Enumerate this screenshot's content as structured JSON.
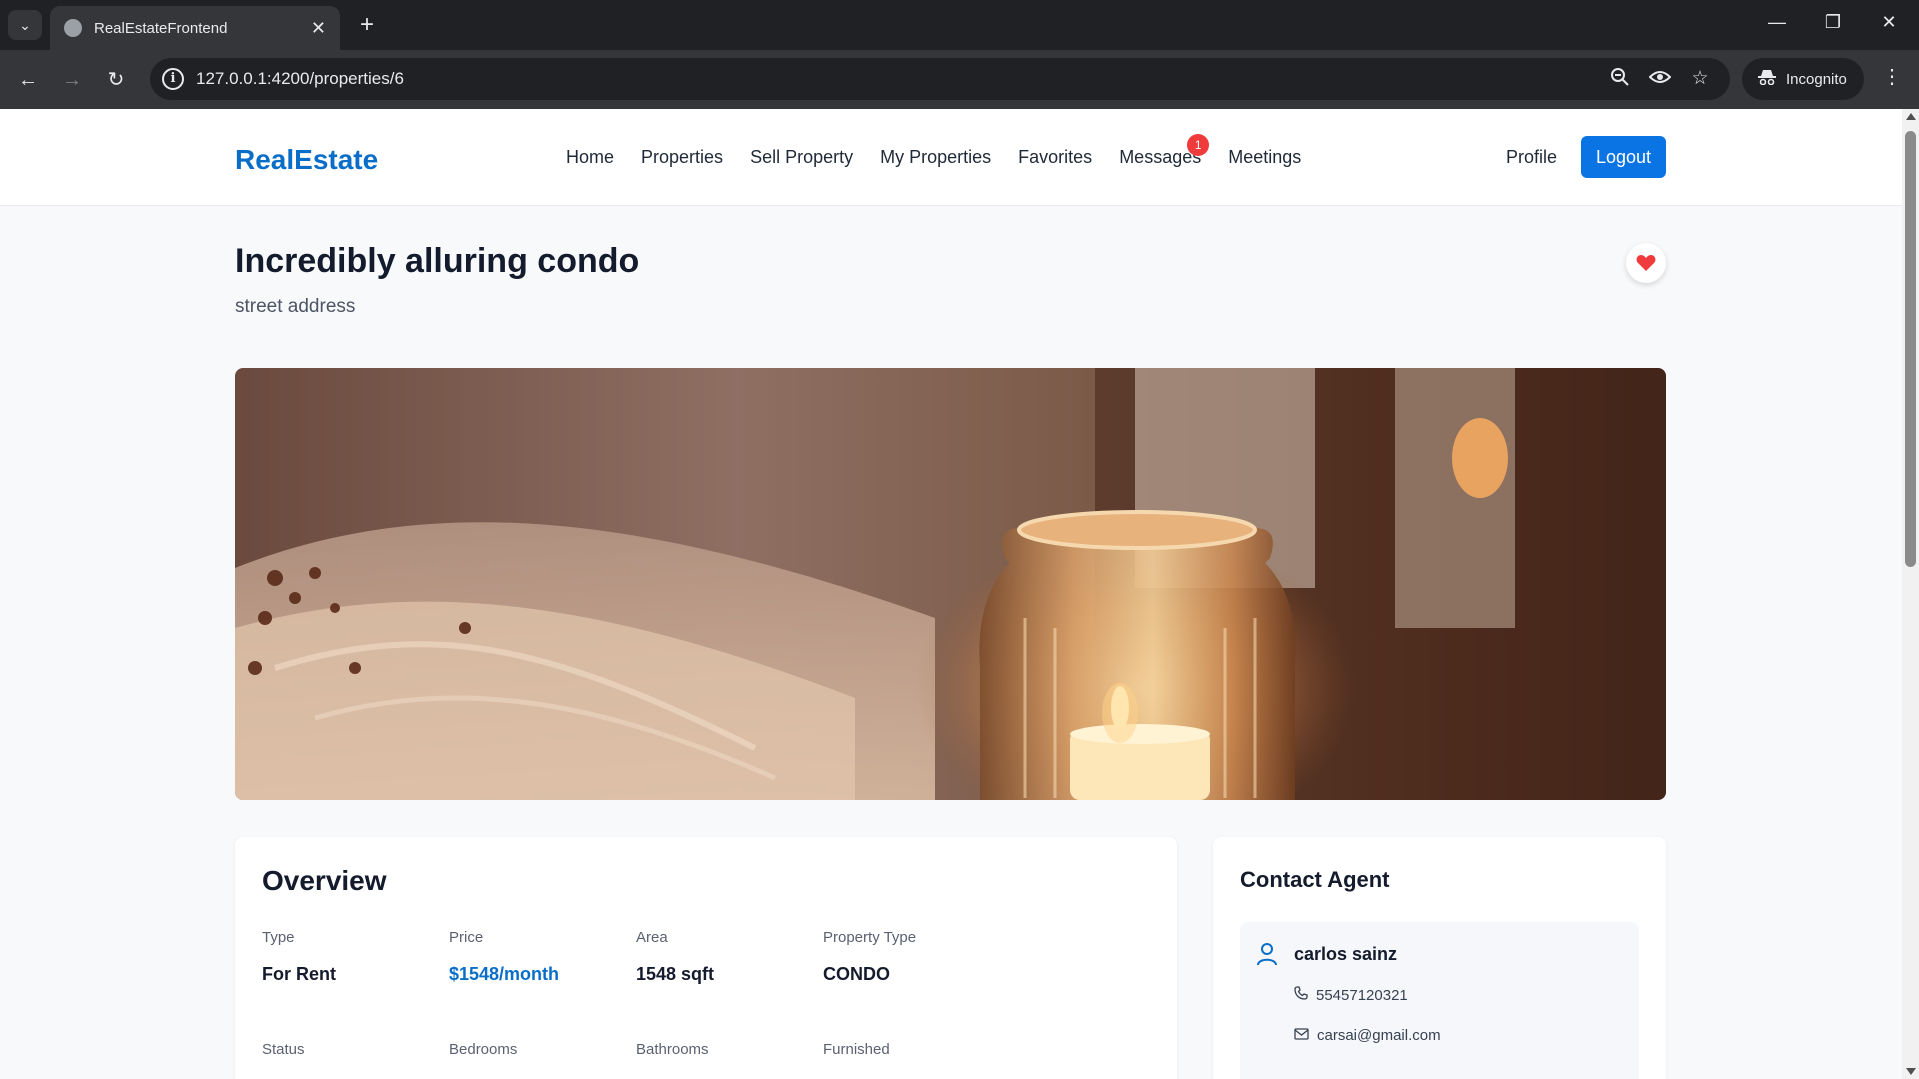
{
  "browser": {
    "tab_title": "RealEstateFrontend",
    "url": "127.0.0.1:4200/properties/6",
    "incognito_label": "Incognito"
  },
  "site": {
    "logo": "RealEstate",
    "nav": {
      "home": "Home",
      "properties": "Properties",
      "sell": "Sell Property",
      "my_properties": "My Properties",
      "favorites": "Favorites",
      "messages": "Messages",
      "messages_badge": "1",
      "meetings": "Meetings"
    },
    "profile": "Profile",
    "logout": "Logout"
  },
  "property": {
    "title": "Incredibly alluring condo",
    "address": "street address",
    "favorited": true
  },
  "overview": {
    "heading": "Overview",
    "items": [
      {
        "label": "Type",
        "value": "For Rent"
      },
      {
        "label": "Price",
        "value": "$1548/month"
      },
      {
        "label": "Area",
        "value": "1548 sqft"
      },
      {
        "label": "Property Type",
        "value": "CONDO"
      },
      {
        "label": "Status",
        "value": ""
      },
      {
        "label": "Bedrooms",
        "value": ""
      },
      {
        "label": "Bathrooms",
        "value": ""
      },
      {
        "label": "Furnished",
        "value": ""
      }
    ]
  },
  "contact": {
    "heading": "Contact Agent",
    "name": "carlos sainz",
    "phone": "55457120321",
    "email": "carsai@gmail.com"
  },
  "colors": {
    "brand": "#0a6ec9",
    "button": "#0b74e5",
    "badge": "#ef3b3b",
    "heart": "#ef3b3b"
  }
}
